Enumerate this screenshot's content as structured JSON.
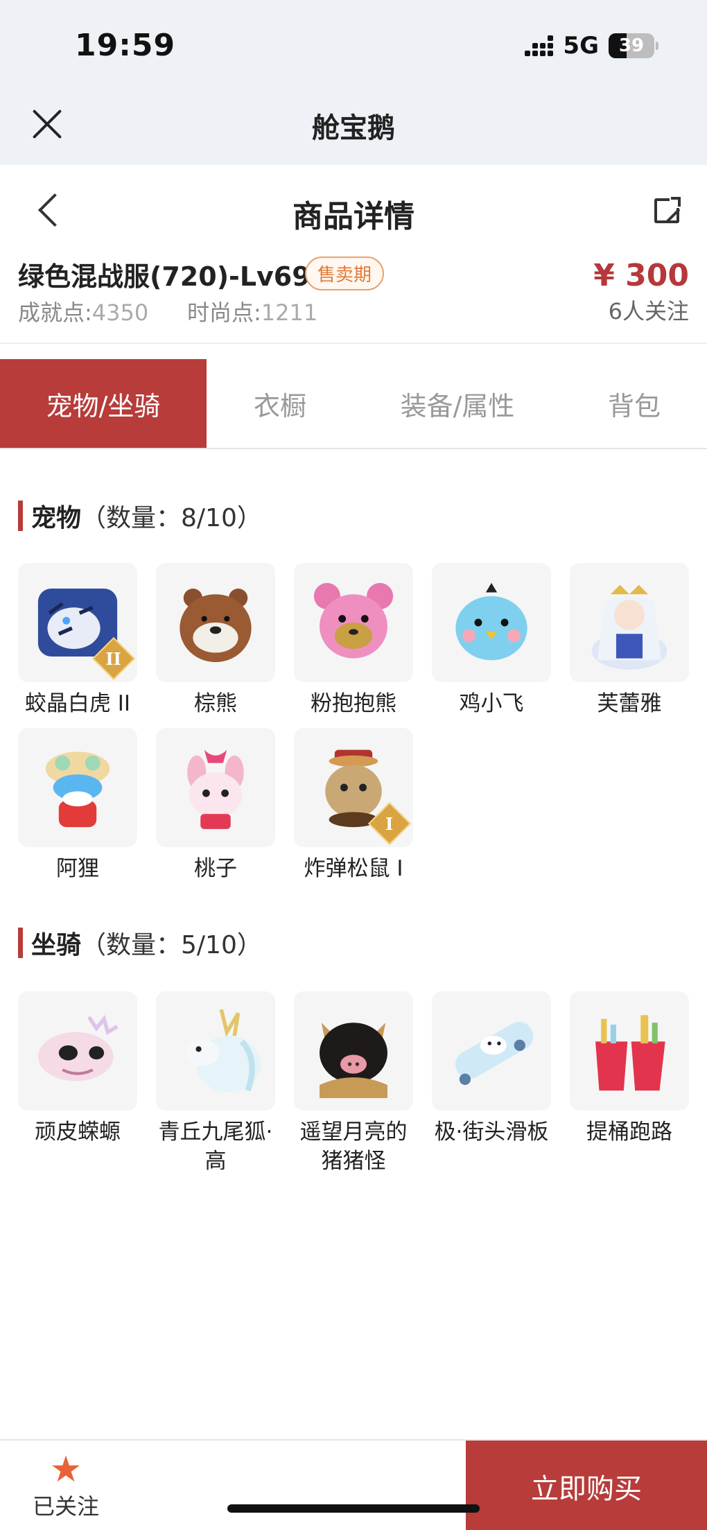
{
  "status": {
    "time": "19:59",
    "network": "5G",
    "battery": "39",
    "battery_level": 0.39
  },
  "app": {
    "title": "舱宝鹅"
  },
  "nav": {
    "title": "商品详情"
  },
  "product": {
    "name": "绿色混战服(720)-Lv69",
    "badge": "售卖期",
    "achievement_label": "成就点:",
    "achievement_value": "4350",
    "fashion_label": "时尚点:",
    "fashion_value": "1211",
    "price": "¥ 300",
    "followers": "6人关注"
  },
  "tabs": [
    {
      "label": "宠物/坐骑",
      "active": true
    },
    {
      "label": "衣橱",
      "active": false
    },
    {
      "label": "装备/属性",
      "active": false
    },
    {
      "label": "背包",
      "active": false
    }
  ],
  "pets": {
    "title": "宠物",
    "count": "（数量：8/10）",
    "items": [
      {
        "label": "蛟晶白虎 II",
        "tier": "II",
        "icon": "tiger-icon"
      },
      {
        "label": "棕熊",
        "icon": "bear-icon"
      },
      {
        "label": "粉抱抱熊",
        "icon": "pink-bear-icon"
      },
      {
        "label": "鸡小飞",
        "icon": "chick-icon"
      },
      {
        "label": "芙蕾雅",
        "icon": "goddess-icon"
      },
      {
        "label": "阿狸",
        "icon": "lion-doll-icon"
      },
      {
        "label": "桃子",
        "icon": "bunny-icon"
      },
      {
        "label": "炸弹松鼠 I",
        "tier": "I",
        "icon": "squirrel-icon"
      }
    ]
  },
  "mounts": {
    "title": "坐骑",
    "count": "（数量：5/10）",
    "items": [
      {
        "label": "顽皮蝾螈",
        "icon": "axolotl-icon"
      },
      {
        "label": "青丘九尾狐·高",
        "icon": "fox-icon"
      },
      {
        "label": "遥望月亮的猪猪怪",
        "icon": "pig-icon"
      },
      {
        "label": "极·街头滑板",
        "icon": "skateboard-icon"
      },
      {
        "label": "提桶跑路",
        "icon": "bucket-icon"
      }
    ]
  },
  "bottom": {
    "follow_label": "已关注",
    "buy_label": "立即购买"
  },
  "colors": {
    "accent": "#b73c3a",
    "badge": "#e07b3a",
    "star": "#e8623a"
  }
}
